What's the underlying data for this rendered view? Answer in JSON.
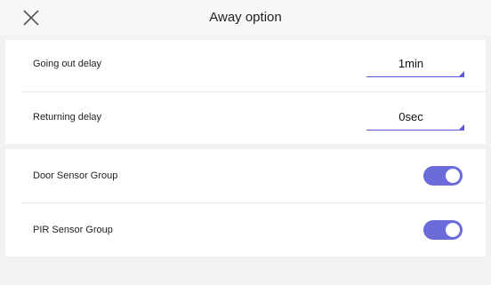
{
  "header": {
    "title": "Away option",
    "close_icon": "close-icon"
  },
  "delays": [
    {
      "label": "Going out delay",
      "value": "1min"
    },
    {
      "label": "Returning delay",
      "value": "0sec"
    }
  ],
  "sensor_groups": [
    {
      "label": "Door Sensor Group",
      "enabled": true
    },
    {
      "label": "PIR Sensor Group",
      "enabled": true
    }
  ],
  "colors": {
    "accent": "#6b6bd9",
    "background": "#f2f2f4",
    "panel": "#ffffff"
  }
}
